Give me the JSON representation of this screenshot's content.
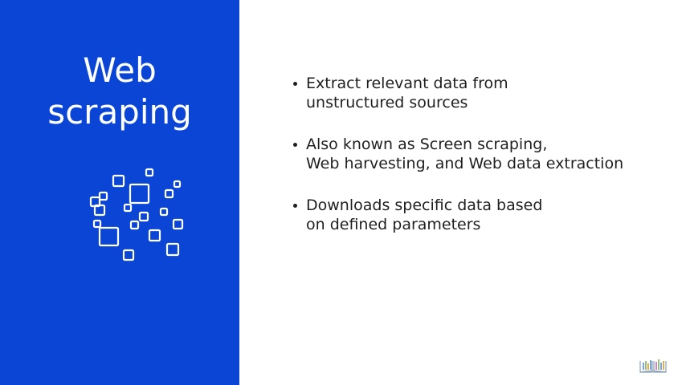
{
  "slide": {
    "title_line1": "Web",
    "title_line2": "scraping",
    "bullets": [
      {
        "line1": "Extract relevant data from",
        "line2": "unstructured sources"
      },
      {
        "line1": "Also known as Screen scraping,",
        "line2": "Web harvesting, and Web data extraction"
      },
      {
        "line1": "Downloads specific data based",
        "line2": "on defined parameters"
      }
    ]
  },
  "colors": {
    "panel": "#0a45d6",
    "title_text": "#ffffff",
    "body_text": "#1f1f1f"
  },
  "icons": {
    "graphic": "scattered-squares-icon",
    "corner": "book-logo-icon"
  }
}
